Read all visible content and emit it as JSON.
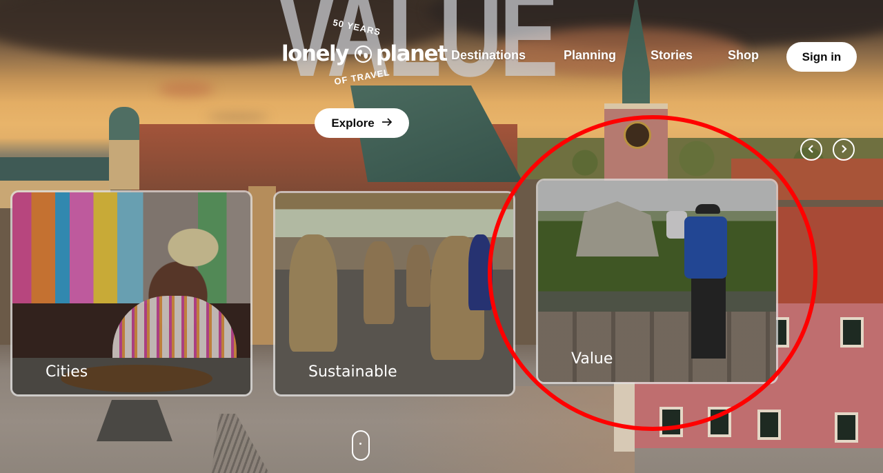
{
  "background": {
    "watermark_word": "VALUE",
    "scene": "Warsaw Old Town at sunset"
  },
  "logo": {
    "arc_top": "50 YEARS",
    "wordmark_left": "lonely",
    "wordmark_right": "planet",
    "arc_bottom": "OF TRAVEL",
    "icon": "globe-icon"
  },
  "nav": {
    "items": [
      {
        "label": "Destinations"
      },
      {
        "label": "Planning"
      },
      {
        "label": "Stories"
      },
      {
        "label": "Shop"
      }
    ],
    "sign_in_label": "Sign in"
  },
  "hero": {
    "explore_label": "Explore",
    "explore_icon": "arrow-right-icon",
    "carousel_prev_icon": "chevron-left-icon",
    "carousel_next_icon": "chevron-right-icon",
    "scroll_indicator_icon": "mouse-scroll-icon"
  },
  "cards": [
    {
      "label": "Cities"
    },
    {
      "label": "Sustainable"
    },
    {
      "label": "Value"
    }
  ],
  "annotation": {
    "color": "#ff0000",
    "highlighted_card": "Value"
  }
}
